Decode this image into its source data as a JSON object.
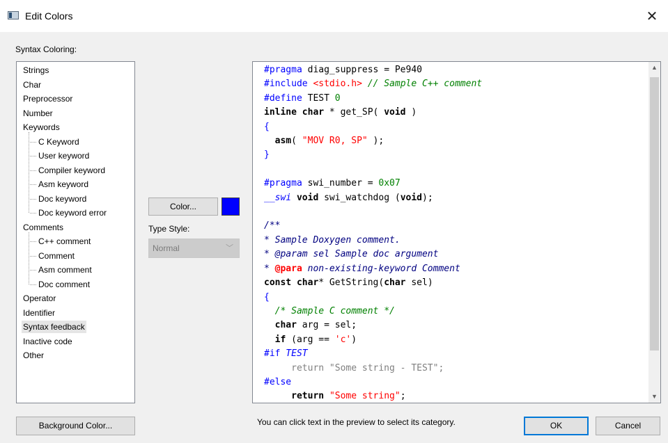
{
  "window": {
    "title": "Edit Colors",
    "close_glyph": "✕"
  },
  "syntax_coloring_label": "Syntax Coloring:",
  "tree": [
    {
      "label": "Strings",
      "level": 0
    },
    {
      "label": "Char",
      "level": 0
    },
    {
      "label": "Preprocessor",
      "level": 0
    },
    {
      "label": "Number",
      "level": 0
    },
    {
      "label": "Keywords",
      "level": 0
    },
    {
      "label": "C Keyword",
      "level": 1
    },
    {
      "label": "User keyword",
      "level": 1
    },
    {
      "label": "Compiler keyword",
      "level": 1
    },
    {
      "label": "Asm keyword",
      "level": 1
    },
    {
      "label": "Doc keyword",
      "level": 1
    },
    {
      "label": "Doc keyword error",
      "level": 1
    },
    {
      "label": "Comments",
      "level": 0
    },
    {
      "label": "C++ comment",
      "level": 1
    },
    {
      "label": "Comment",
      "level": 1
    },
    {
      "label": "Asm comment",
      "level": 1
    },
    {
      "label": "Doc comment",
      "level": 1
    },
    {
      "label": "Operator",
      "level": 0
    },
    {
      "label": "Identifier",
      "level": 0
    },
    {
      "label": "Syntax feedback",
      "level": 0,
      "selected": true
    },
    {
      "label": "Inactive code",
      "level": 0
    },
    {
      "label": "Other",
      "level": 0
    }
  ],
  "color_button": {
    "label": "Color...",
    "swatch": "#0000ff"
  },
  "type_style": {
    "label": "Type Style:",
    "value": "Normal"
  },
  "colors": {
    "preprocessor": "#0000ff",
    "string": "#ff0000",
    "cpp_comment": "#008000",
    "number": "#008000",
    "keyword": "#000000",
    "compiler_keyword": "#0000ff",
    "doc_comment": "#000080",
    "doc_keyword_error": "#ff0000",
    "inactive": "#808080",
    "operator": "#000000"
  },
  "code_lines": [
    [
      {
        "t": "#pragma",
        "c": "preprocessor"
      },
      {
        "t": " diag_suppress = Pe940",
        "c": "plain"
      }
    ],
    [
      {
        "t": "#include ",
        "c": "preprocessor"
      },
      {
        "t": "<stdio.h>",
        "c": "string"
      },
      {
        "t": " ",
        "c": "plain"
      },
      {
        "t": "// Sample C++ comment",
        "c": "cpp_comment",
        "i": true
      }
    ],
    [
      {
        "t": "#define",
        "c": "preprocessor"
      },
      {
        "t": " TEST ",
        "c": "plain"
      },
      {
        "t": "0",
        "c": "number"
      }
    ],
    [
      {
        "t": "inline char",
        "c": "keyword",
        "b": true
      },
      {
        "t": " * get_SP( ",
        "c": "plain"
      },
      {
        "t": "void",
        "c": "keyword",
        "b": true
      },
      {
        "t": " )",
        "c": "plain"
      }
    ],
    [
      {
        "t": "{",
        "c": "preprocessor"
      }
    ],
    [
      {
        "t": "  ",
        "c": "plain"
      },
      {
        "t": "asm",
        "c": "keyword",
        "b": true
      },
      {
        "t": "( ",
        "c": "plain"
      },
      {
        "t": "\"MOV R0, SP\"",
        "c": "string"
      },
      {
        "t": " );",
        "c": "plain"
      }
    ],
    [
      {
        "t": "}",
        "c": "preprocessor"
      }
    ],
    [
      {
        "t": "",
        "c": "plain"
      }
    ],
    [
      {
        "t": "#pragma",
        "c": "preprocessor"
      },
      {
        "t": " swi_number = ",
        "c": "plain"
      },
      {
        "t": "0x07",
        "c": "number"
      }
    ],
    [
      {
        "t": "__swi",
        "c": "compiler_keyword",
        "i": true
      },
      {
        "t": " ",
        "c": "plain"
      },
      {
        "t": "void",
        "c": "keyword",
        "b": true
      },
      {
        "t": " swi_watchdog (",
        "c": "plain"
      },
      {
        "t": "void",
        "c": "keyword",
        "b": true
      },
      {
        "t": ");",
        "c": "plain"
      }
    ],
    [
      {
        "t": "",
        "c": "plain"
      }
    ],
    [
      {
        "t": "/**",
        "c": "doc_comment",
        "i": true
      }
    ],
    [
      {
        "t": "* Sample Doxygen comment.",
        "c": "doc_comment",
        "i": true
      }
    ],
    [
      {
        "t": "* ",
        "c": "doc_comment",
        "i": true
      },
      {
        "t": "@param",
        "c": "doc_comment",
        "i": true
      },
      {
        "t": " sel Sample doc argument",
        "c": "doc_comment",
        "i": true
      }
    ],
    [
      {
        "t": "* ",
        "c": "doc_comment",
        "i": true
      },
      {
        "t": "@para",
        "c": "doc_keyword_error",
        "b": true
      },
      {
        "t": " non-existing-keyword Comment",
        "c": "doc_comment",
        "i": true
      }
    ],
    [
      {
        "t": "const char",
        "c": "keyword",
        "b": true
      },
      {
        "t": "* GetString(",
        "c": "plain"
      },
      {
        "t": "char",
        "c": "keyword",
        "b": true
      },
      {
        "t": " sel)",
        "c": "plain"
      }
    ],
    [
      {
        "t": "{",
        "c": "preprocessor"
      }
    ],
    [
      {
        "t": "  ",
        "c": "plain"
      },
      {
        "t": "/* Sample C comment */",
        "c": "cpp_comment",
        "i": true
      }
    ],
    [
      {
        "t": "  ",
        "c": "plain"
      },
      {
        "t": "char",
        "c": "keyword",
        "b": true
      },
      {
        "t": " arg = sel;",
        "c": "plain"
      }
    ],
    [
      {
        "t": "  ",
        "c": "plain"
      },
      {
        "t": "if",
        "c": "keyword",
        "b": true
      },
      {
        "t": " (arg == ",
        "c": "plain"
      },
      {
        "t": "'c'",
        "c": "string"
      },
      {
        "t": ")",
        "c": "plain"
      }
    ],
    [
      {
        "t": "#if",
        "c": "preprocessor"
      },
      {
        "t": " TEST",
        "c": "preprocessor",
        "i": true
      }
    ],
    [
      {
        "t": "     return \"Some string - TEST\";",
        "c": "inactive"
      }
    ],
    [
      {
        "t": "#else",
        "c": "preprocessor"
      }
    ],
    [
      {
        "t": "     ",
        "c": "plain"
      },
      {
        "t": "return",
        "c": "keyword",
        "b": true
      },
      {
        "t": " ",
        "c": "plain"
      },
      {
        "t": "\"Some string\"",
        "c": "string"
      },
      {
        "t": ";",
        "c": "plain"
      }
    ]
  ],
  "scrollbar": {
    "up_glyph": "▲",
    "down_glyph": "▼"
  },
  "background_color_button": "Background Color...",
  "hint_text": "You can click text in the preview to select its category.",
  "ok_button": "OK",
  "cancel_button": "Cancel"
}
